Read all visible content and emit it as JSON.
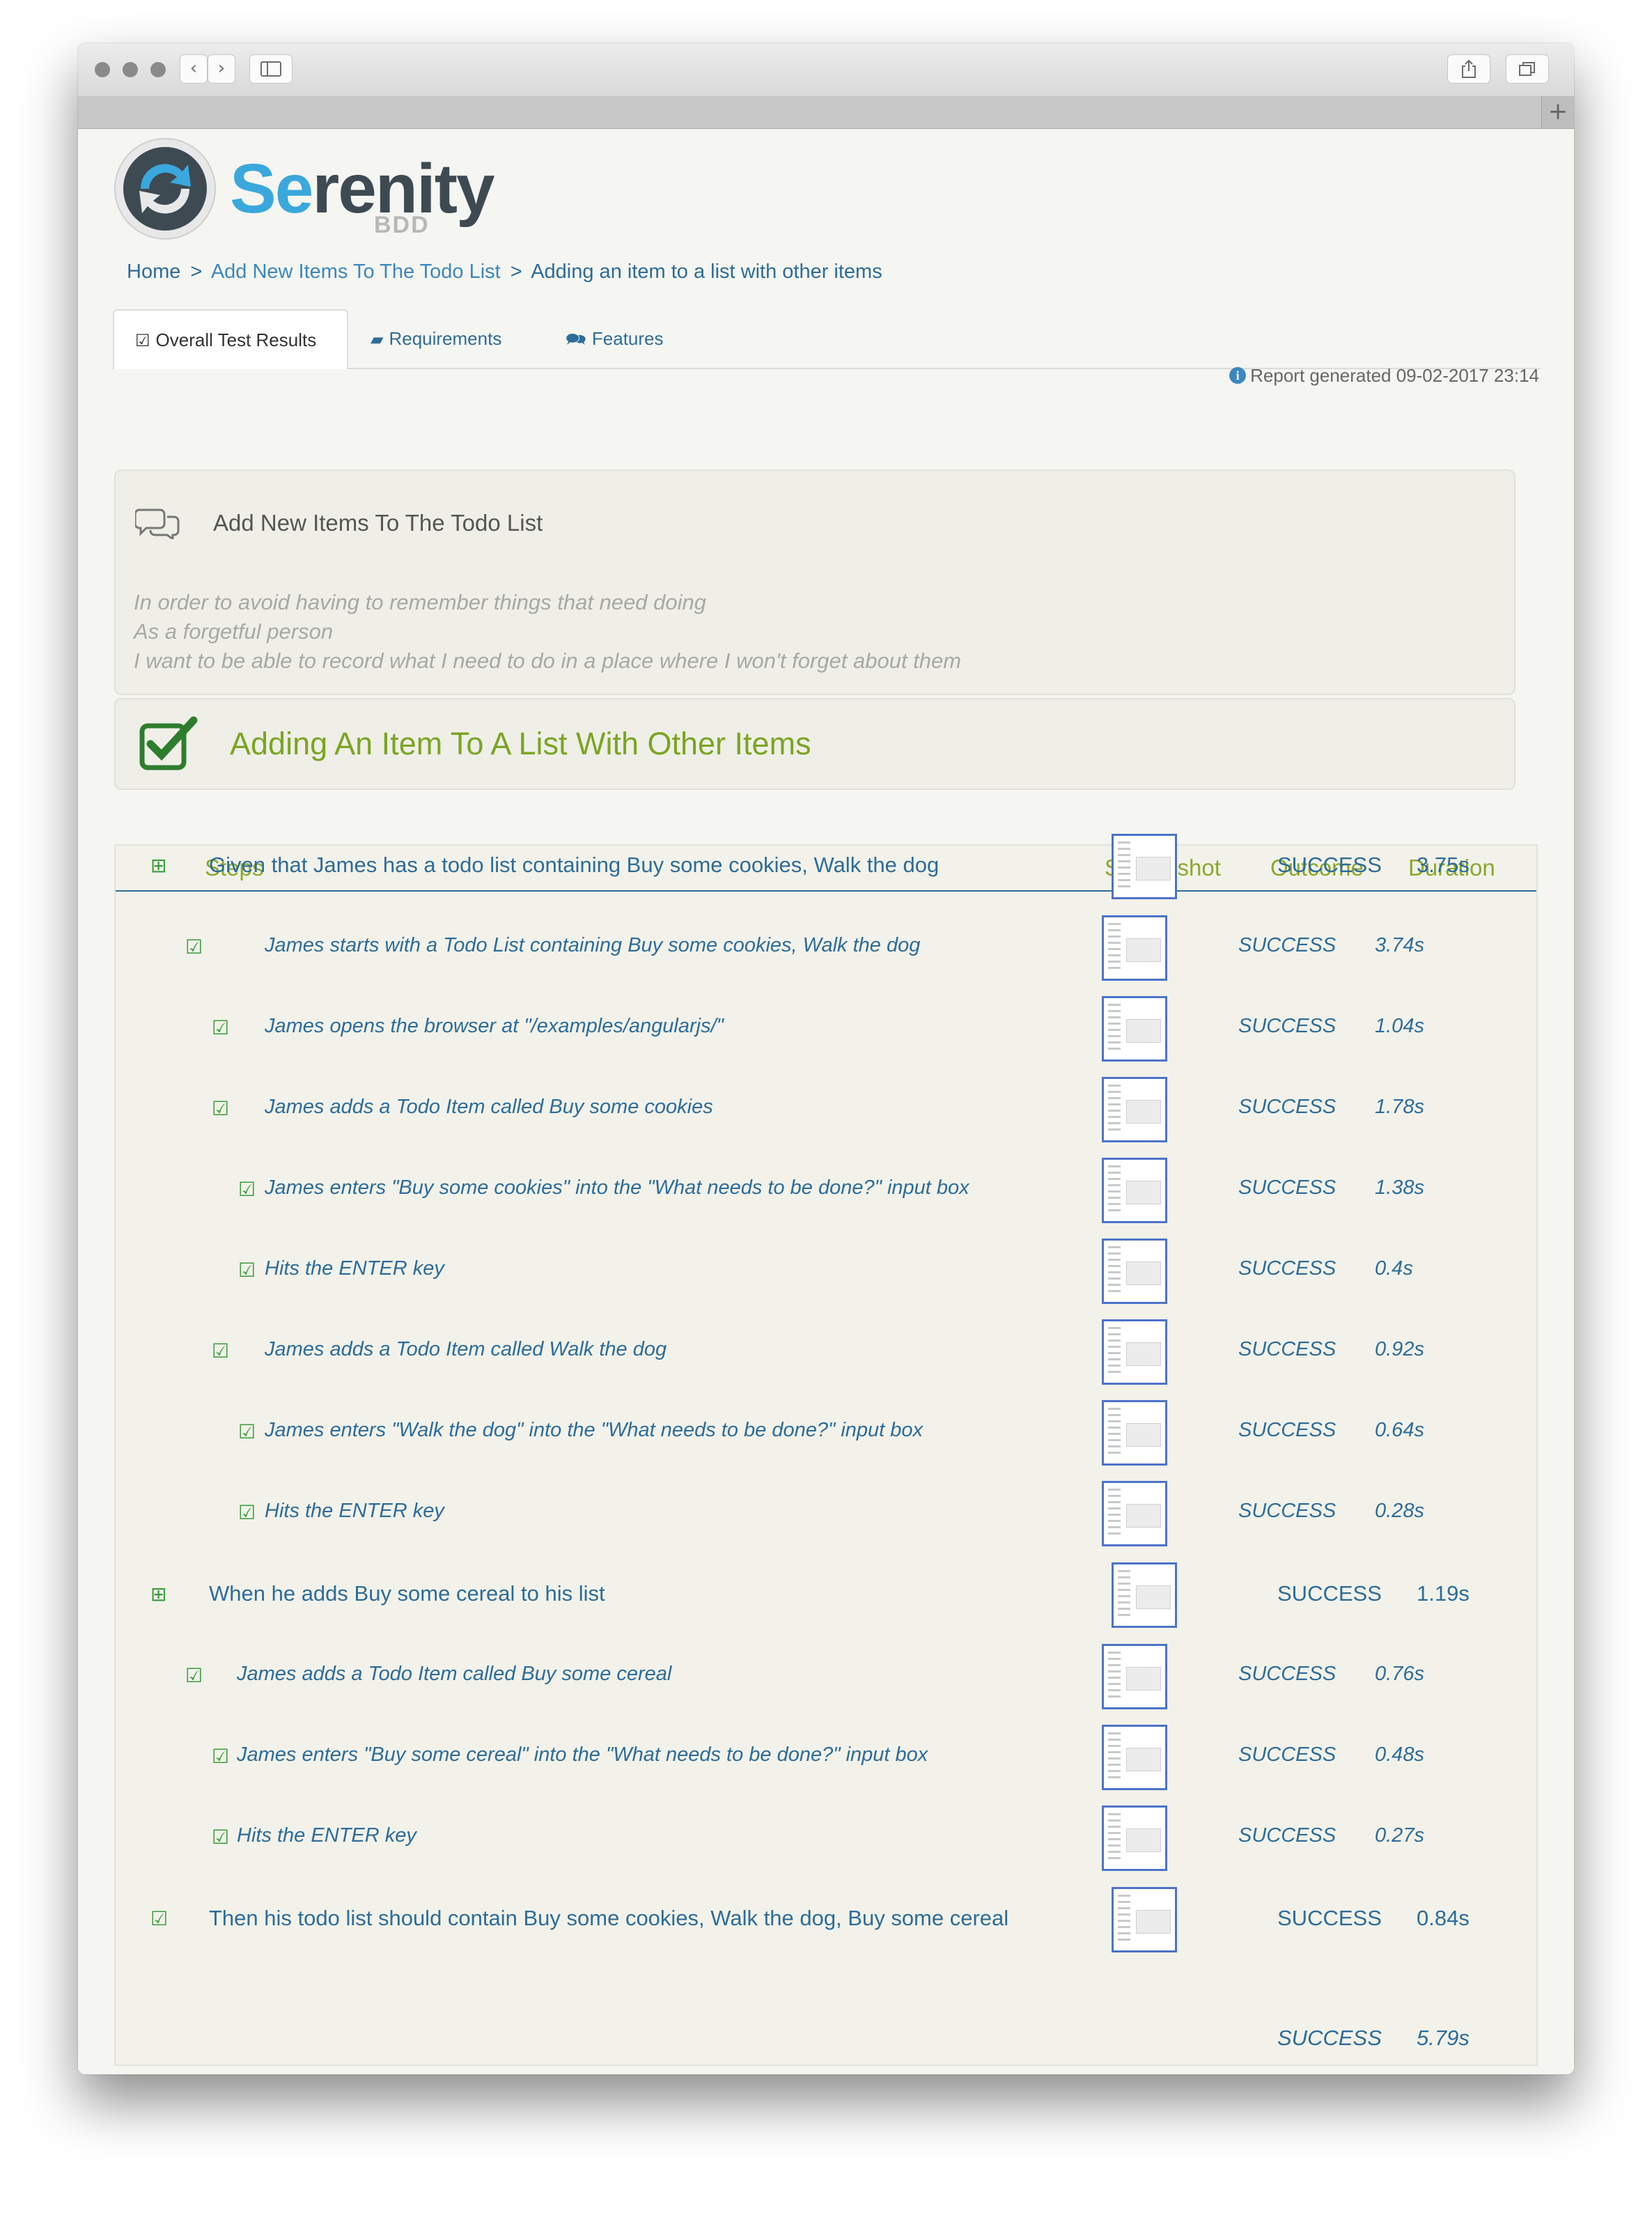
{
  "browser": {
    "back_label": "‹",
    "forward_label": "›",
    "new_tab_label": "+"
  },
  "brand": {
    "name_hl": "Se",
    "name_rest": "renity",
    "sub": "BDD"
  },
  "breadcrumb": {
    "home": "Home",
    "sep1": ">",
    "feature": "Add New Items To The Todo List",
    "sep2": ">",
    "current": "Adding an item to a list with other items"
  },
  "tabs": [
    {
      "icon": "check-square-icon",
      "label": "Overall Test Results"
    },
    {
      "icon": "book-icon",
      "label": "Requirements"
    },
    {
      "icon": "comments-icon",
      "label": "Features"
    }
  ],
  "report": {
    "label": "Report generated 09-02-2017 23:14"
  },
  "feature": {
    "title": "Add New Items To The Todo List",
    "narrative": [
      "In order to avoid having to remember things that need doing",
      "As a forgetful person",
      "I want to be able to record what I need to do in a place where I won't forget about them"
    ]
  },
  "scenario": {
    "title": "Adding An Item To A List With Other Items"
  },
  "table": {
    "headers": {
      "steps": "Steps",
      "screenshot": "Screenshot",
      "outcome": "Outcome",
      "duration": "Duration"
    },
    "rows": [
      {
        "level": 0,
        "icon": "expand-icon",
        "text": "Given that James has a todo list containing Buy some cookies, Walk the dog",
        "outcome": "SUCCESS",
        "duration": "3.75s"
      },
      {
        "level": 1,
        "icon": "check-icon",
        "text": "James starts with a Todo List containing Buy some cookies, Walk the dog",
        "outcome": "SUCCESS",
        "duration": "3.74s"
      },
      {
        "level": 2,
        "icon": "check-icon",
        "text": "James opens the browser at \"/examples/angularjs/\"",
        "outcome": "SUCCESS",
        "duration": "1.04s"
      },
      {
        "level": 2,
        "icon": "check-icon",
        "text": "James adds a Todo Item called Buy some cookies",
        "outcome": "SUCCESS",
        "duration": "1.78s"
      },
      {
        "level": 3,
        "icon": "check-icon",
        "text": "James enters \"Buy some cookies\" into the \"What needs to be done?\" input box",
        "outcome": "SUCCESS",
        "duration": "1.38s"
      },
      {
        "level": 3,
        "icon": "check-icon",
        "text": "Hits the ENTER key",
        "outcome": "SUCCESS",
        "duration": "0.4s"
      },
      {
        "level": 2,
        "icon": "check-icon",
        "text": "James adds a Todo Item called Walk the dog",
        "outcome": "SUCCESS",
        "duration": "0.92s"
      },
      {
        "level": 3,
        "icon": "check-icon",
        "text": "James enters \"Walk the dog\" into the \"What needs to be done?\" input box",
        "outcome": "SUCCESS",
        "duration": "0.64s"
      },
      {
        "level": 3,
        "icon": "check-icon",
        "text": "Hits the ENTER key",
        "outcome": "SUCCESS",
        "duration": "0.28s"
      },
      {
        "level": 0,
        "icon": "expand-icon",
        "text": "When he adds Buy some cereal to his list",
        "outcome": "SUCCESS",
        "duration": "1.19s"
      },
      {
        "level": 1,
        "icon": "check-icon",
        "text": "James adds a Todo Item called Buy some cereal",
        "outcome": "SUCCESS",
        "duration": "0.76s"
      },
      {
        "level": 2,
        "icon": "check-icon",
        "text": "James enters \"Buy some cereal\" into the \"What needs to be done?\" input box",
        "outcome": "SUCCESS",
        "duration": "0.48s"
      },
      {
        "level": 2,
        "icon": "check-icon",
        "text": "Hits the ENTER key",
        "outcome": "SUCCESS",
        "duration": "0.27s"
      },
      {
        "level": 0,
        "icon": "check-icon",
        "text": "Then his todo list should contain Buy some cookies, Walk the dog, Buy some cereal",
        "outcome": "SUCCESS",
        "duration": "0.84s"
      }
    ],
    "total": {
      "outcome": "SUCCESS",
      "duration": "5.79s"
    }
  },
  "colors": {
    "link": "#2d6c99",
    "success_green": "#7ba521",
    "check_green": "#3a9c3a",
    "header_green": "#8aa82a",
    "thumb_border": "#4d73c9"
  }
}
